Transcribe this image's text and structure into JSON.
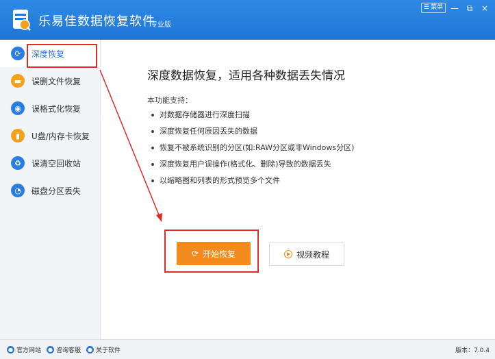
{
  "app": {
    "title": "乐易佳数据恢复软件",
    "edition": "专业版",
    "menu_label": "菜单",
    "minimize": "—",
    "close": "×"
  },
  "sidebar": {
    "items": [
      {
        "label": "深度恢复",
        "icon": "refresh-icon",
        "color": "#2a7de1"
      },
      {
        "label": "误删文件恢复",
        "icon": "folder-icon",
        "color": "#f2a01e"
      },
      {
        "label": "误格式化恢复",
        "icon": "disk-icon",
        "color": "#2a7de1"
      },
      {
        "label": "U盘/内存卡恢复",
        "icon": "usb-icon",
        "color": "#f2a01e"
      },
      {
        "label": "误清空回收站",
        "icon": "recycle-bin-icon",
        "color": "#2a7de1"
      },
      {
        "label": "磁盘分区丢失",
        "icon": "partition-icon",
        "color": "#2a7de1"
      }
    ]
  },
  "main": {
    "heading": "深度数据恢复，适用各种数据丢失情况",
    "support_title": "本功能支持：",
    "features": [
      "对数据存储器进行深度扫描",
      "深度恢复任何原因丢失的数据",
      "恢复不被系统识别的分区(如:RAW分区或非Windows分区)",
      "深度恢复用户误操作(格式化、删除)导致的数据丢失",
      "以缩略图和列表的形式预览多个文件"
    ],
    "start_label": "开始恢复",
    "video_label": "视频教程"
  },
  "footer": {
    "website": "官方网站",
    "support": "咨询客服",
    "about": "关于软件",
    "version": "版本：7.0.4"
  },
  "colors": {
    "brand_blue": "#1f75d6",
    "accent_orange": "#f28a1c",
    "annotation_red": "#e02b2b"
  }
}
